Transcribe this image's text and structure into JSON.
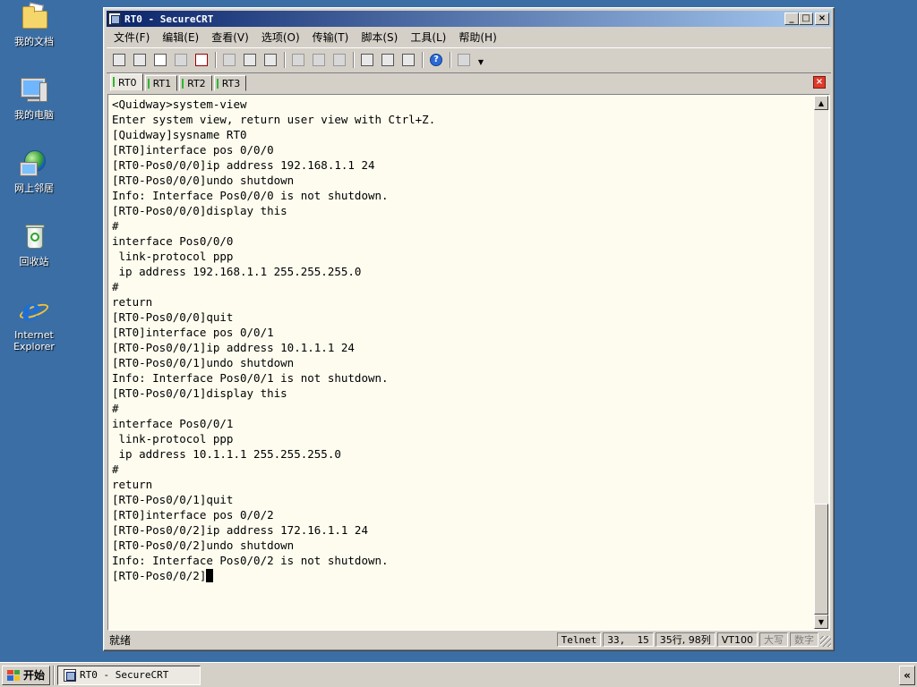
{
  "desktop": {
    "icons": [
      {
        "label": "我的文档"
      },
      {
        "label": "我的电脑"
      },
      {
        "label": "网上邻居"
      },
      {
        "label": "回收站"
      },
      {
        "label": "Internet Explorer"
      }
    ]
  },
  "window": {
    "title": "RT0 - SecureCRT",
    "buttons": {
      "minimize": "_",
      "maximize": "□",
      "close": "×"
    }
  },
  "menubar": {
    "items": [
      {
        "label": "文件(F)"
      },
      {
        "label": "编辑(E)"
      },
      {
        "label": "查看(V)"
      },
      {
        "label": "选项(O)"
      },
      {
        "label": "传输(T)"
      },
      {
        "label": "脚本(S)"
      },
      {
        "label": "工具(L)"
      },
      {
        "label": "帮助(H)"
      }
    ]
  },
  "toolbar": {
    "help_glyph": "?",
    "icons": [
      "connect-icon",
      "quick-connect-icon",
      "connect-tab-icon",
      "reconnect-icon",
      "disconnect-icon",
      "copy-icon",
      "paste-icon",
      "find-icon",
      "print-icon",
      "print-setup-icon",
      "print-screen-icon",
      "session-options-icon",
      "global-options-icon",
      "keymap-icon",
      "help-icon",
      "sftp-icon"
    ]
  },
  "tabs": [
    {
      "label": "RT0",
      "active": true
    },
    {
      "label": "RT1",
      "active": false
    },
    {
      "label": "RT2",
      "active": false
    },
    {
      "label": "RT3",
      "active": false
    }
  ],
  "tab_close": "×",
  "terminal": {
    "lines": [
      "<Quidway>system-view",
      "Enter system view, return user view with Ctrl+Z.",
      "[Quidway]sysname RT0",
      "[RT0]interface pos 0/0/0",
      "[RT0-Pos0/0/0]ip address 192.168.1.1 24",
      "[RT0-Pos0/0/0]undo shutdown",
      "Info: Interface Pos0/0/0 is not shutdown.",
      "[RT0-Pos0/0/0]display this",
      "#",
      "interface Pos0/0/0",
      " link-protocol ppp",
      " ip address 192.168.1.1 255.255.255.0",
      "#",
      "return",
      "[RT0-Pos0/0/0]quit",
      "[RT0]interface pos 0/0/1",
      "[RT0-Pos0/0/1]ip address 10.1.1.1 24",
      "[RT0-Pos0/0/1]undo shutdown",
      "Info: Interface Pos0/0/1 is not shutdown.",
      "[RT0-Pos0/0/1]display this",
      "#",
      "interface Pos0/0/1",
      " link-protocol ppp",
      " ip address 10.1.1.1 255.255.255.0",
      "#",
      "return",
      "[RT0-Pos0/0/1]quit",
      "[RT0]interface pos 0/0/2",
      "[RT0-Pos0/0/2]ip address 172.16.1.1 24",
      "[RT0-Pos0/0/2]undo shutdown",
      "Info: Interface Pos0/0/2 is not shutdown."
    ],
    "prompt": "[RT0-Pos0/0/2]"
  },
  "statusbar": {
    "ready": "就绪",
    "protocol": "Telnet",
    "cursor_pos": "33,  15",
    "size": "35行, 98列",
    "emulation": "VT100",
    "caps": "大写",
    "num": "数字"
  },
  "taskbar": {
    "start": "开始",
    "task_title": "RT0 - SecureCRT",
    "tray_toggle": "«"
  },
  "colors": {
    "desktop": "#3a6ea5",
    "terminal_bg": "#fdfcef",
    "title_gradient_start": "#0a246a",
    "title_gradient_end": "#a6caf0"
  }
}
